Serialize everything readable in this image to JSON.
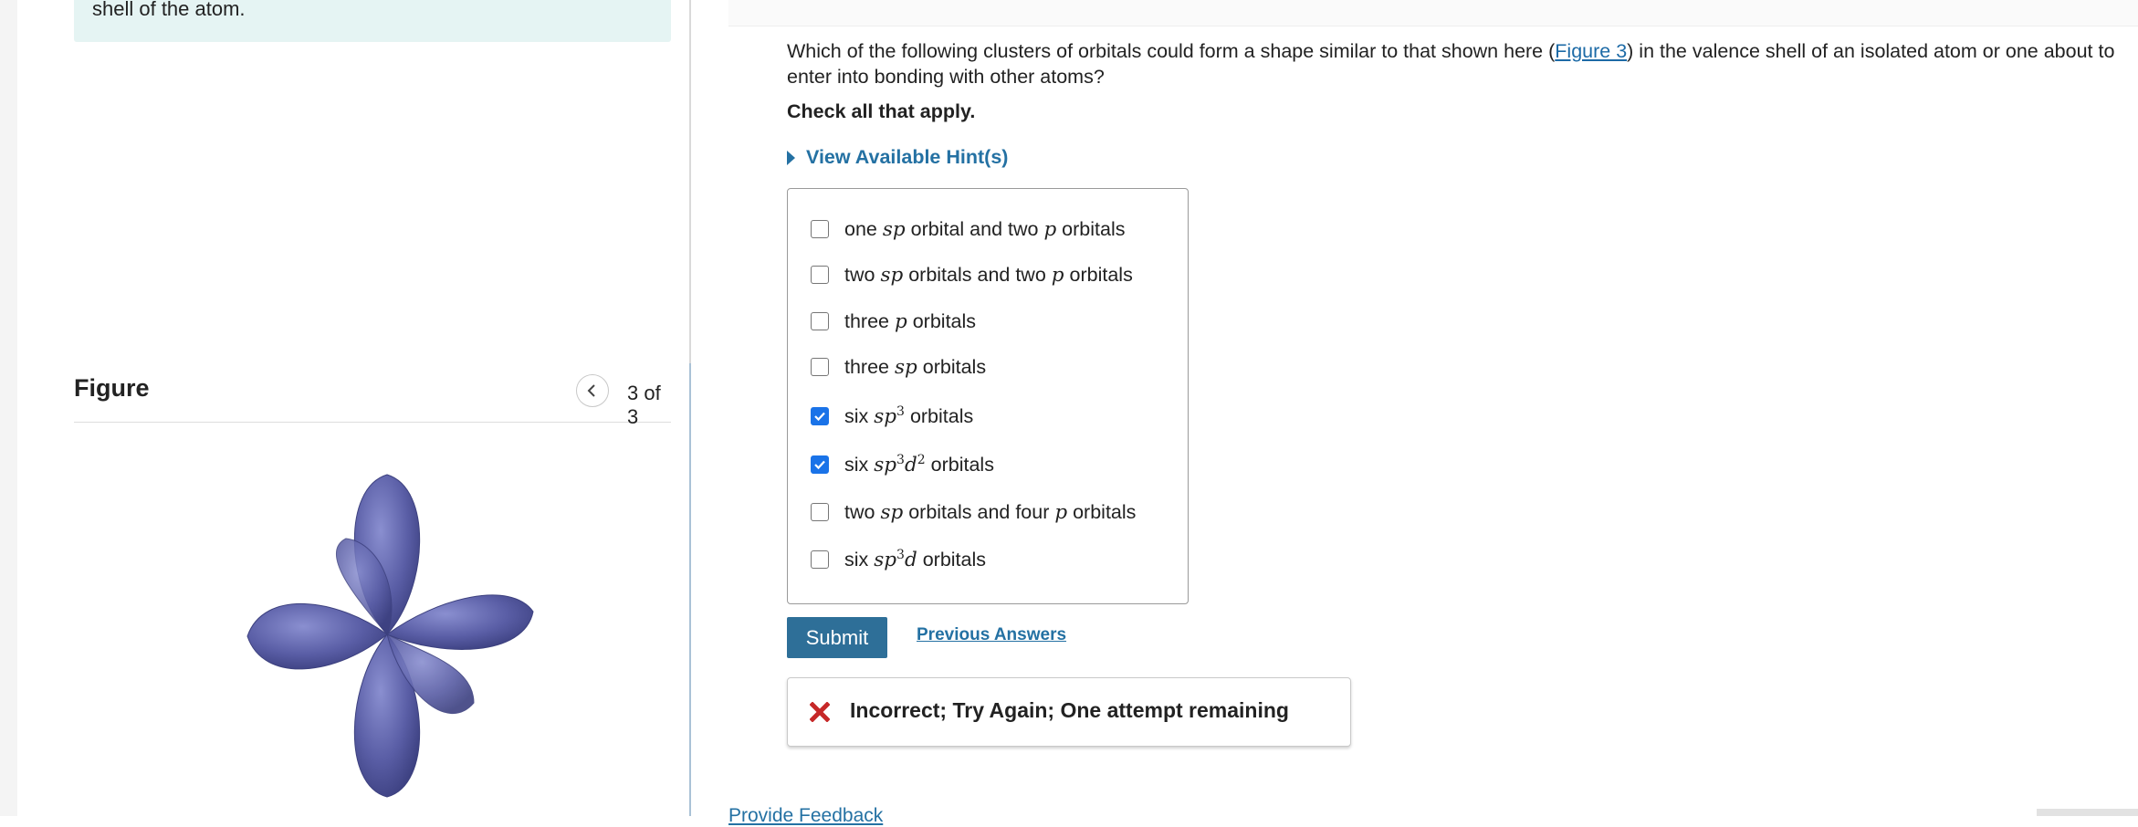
{
  "context": {
    "text": "shell of the atom."
  },
  "figure": {
    "title": "Figure",
    "counter": "3 of 3",
    "prev_icon": "chevron-left-icon",
    "next_icon": "chevron-right-icon",
    "image_color": "#5a5ea6"
  },
  "question": {
    "text_before": "Which of the following clusters of orbitals could form a shape similar to that shown here (",
    "link_text": "Figure 3",
    "text_after": ") in the valence shell of an isolated atom or one about to enter into bonding with other atoms?",
    "instruction": "Check all that apply.",
    "hint_label": "View Available Hint(s)"
  },
  "options": [
    {
      "checked": false,
      "parts": [
        "one ",
        "sp",
        " orbital and two ",
        "p",
        " orbitals"
      ]
    },
    {
      "checked": false,
      "parts": [
        "two ",
        "sp",
        " orbitals and two ",
        "p",
        " orbitals"
      ]
    },
    {
      "checked": false,
      "parts": [
        "three ",
        "p",
        " orbitals"
      ]
    },
    {
      "checked": false,
      "parts": [
        "three ",
        "sp",
        " orbitals"
      ]
    },
    {
      "checked": true,
      "parts": [
        "six ",
        "sp",
        "3",
        " orbitals"
      ]
    },
    {
      "checked": true,
      "parts": [
        "six ",
        "sp",
        "3",
        "d",
        "2",
        " orbitals"
      ]
    },
    {
      "checked": false,
      "parts": [
        "two ",
        "sp",
        " orbitals and four ",
        "p",
        " orbitals"
      ]
    },
    {
      "checked": false,
      "parts": [
        "six ",
        "sp",
        "3",
        "d",
        " orbitals"
      ]
    }
  ],
  "actions": {
    "submit_label": "Submit",
    "previous_answers_label": "Previous Answers"
  },
  "feedback": {
    "icon": "x-icon",
    "icon_color": "#c62828",
    "text": "Incorrect; Try Again; One attempt remaining"
  },
  "footer": {
    "link_text": "Provide Feedback"
  },
  "colors": {
    "accent": "#2471a3",
    "checkbox_checked": "#1a73e8",
    "submit_bg": "#2e6f98",
    "context_bg": "#e5f4f3"
  }
}
